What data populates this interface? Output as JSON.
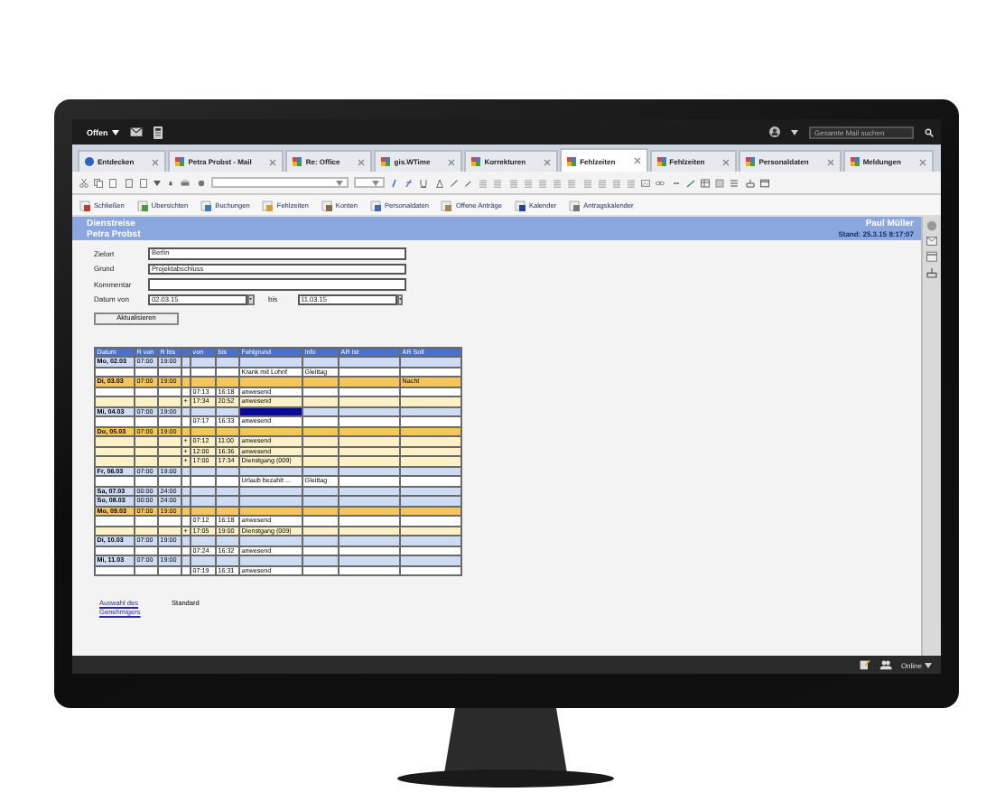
{
  "topbar": {
    "menu": "Offen",
    "search": {
      "placeholder": "Gesamte Mail suchen"
    }
  },
  "tabs": [
    {
      "label": "Entdecken",
      "selected": false
    },
    {
      "label": "Petra Probst - Mail",
      "selected": false
    },
    {
      "label": "Re: Office",
      "selected": false
    },
    {
      "label": "gis.WTime",
      "selected": false
    },
    {
      "label": "Korrekturen",
      "selected": false
    },
    {
      "label": "Fehlzeiten",
      "selected": true
    },
    {
      "label": "Fehlzeiten",
      "selected": false
    },
    {
      "label": "Personaldaten",
      "selected": false
    },
    {
      "label": "Meldungen",
      "selected": false
    }
  ],
  "app_toolbar": [
    "Schließen",
    "Übersichten",
    "Buchungen",
    "Fehlzeiten",
    "Konten",
    "Personaldaten",
    "Offene Anträge",
    "Kalender",
    "Antragskalender"
  ],
  "header": {
    "title": "Dienstreise",
    "person": "Petra Probst",
    "user": "Paul Müller",
    "stand": "Stand: 25.3.15 8:17:07"
  },
  "form": {
    "fields": [
      {
        "label": "Zielort",
        "value": "Berlin"
      },
      {
        "label": "Grund",
        "value": "Projektabschluss"
      },
      {
        "label": "Kommentar"
      }
    ],
    "date": {
      "label": "Datum",
      "from_label": "von",
      "from": "02.03.15",
      "to_label": "bis",
      "to": "11.03.15"
    },
    "button": "Aktualisieren"
  },
  "table": {
    "columns": [
      "Datum",
      "R von",
      "R bis",
      "von",
      "bis",
      "Fehlgrund",
      "Info",
      "AR Ist",
      "AR Soll"
    ],
    "rows": [
      {
        "kind": "day",
        "date": "Mo, 02.03",
        "r_from": "07:00",
        "r_to": "19:00",
        "highlighted": false
      },
      {
        "kind": "entry",
        "reason": "Krank mit Lohnf",
        "info": "Gleittag",
        "highlighted": false
      },
      {
        "kind": "day-flagged",
        "date": "Di, 03.03",
        "r_from": "07:00",
        "r_to": "19:00",
        "ar_soll": "Nacht",
        "highlighted": false
      },
      {
        "kind": "entry",
        "from": "07:13",
        "to": "16:18",
        "reason": "anwesend",
        "highlighted": false
      },
      {
        "kind": "entry-extra",
        "mark": "+",
        "from": "17:34",
        "to": "20:52",
        "reason": "anwesend",
        "highlighted": false
      },
      {
        "kind": "day",
        "date": "Mi, 04.03",
        "r_from": "07:00",
        "r_to": "19:00",
        "highlighted": true
      },
      {
        "kind": "entry",
        "from": "07:17",
        "to": "16:33",
        "reason": "anwesend",
        "highlighted": false
      },
      {
        "kind": "day-flagged",
        "date": "Do, 05.03",
        "r_from": "07:00",
        "r_to": "19:00",
        "highlighted": false
      },
      {
        "kind": "entry-extra",
        "mark": "+",
        "from": "07:12",
        "to": "11:00",
        "reason": "anwesend",
        "highlighted": false
      },
      {
        "kind": "entry-extra",
        "mark": "+",
        "from": "12:00",
        "to": "16:36",
        "reason": "anwesend",
        "highlighted": false
      },
      {
        "kind": "entry-extra",
        "mark": "+",
        "from": "17:00",
        "to": "17:34",
        "reason": "Dienstgang (009)",
        "highlighted": false
      },
      {
        "kind": "day",
        "date": "Fr, 06.03",
        "r_from": "07:00",
        "r_to": "19:00",
        "highlighted": false
      },
      {
        "kind": "entry",
        "reason": "Urlaub bezahlt ...",
        "info": "Gleittag",
        "highlighted": false
      },
      {
        "kind": "day",
        "date": "Sa, 07.03",
        "r_from": "00:00",
        "r_to": "24:00",
        "highlighted": false
      },
      {
        "kind": "day",
        "date": "So, 08.03",
        "r_from": "00:00",
        "r_to": "24:00",
        "highlighted": false
      },
      {
        "kind": "day-flagged",
        "date": "Mo, 09.03",
        "r_from": "07:00",
        "r_to": "19:00",
        "highlighted": false
      },
      {
        "kind": "entry",
        "from": "07:12",
        "to": "16:18",
        "reason": "anwesend",
        "highlighted": false
      },
      {
        "kind": "entry-extra",
        "mark": "+",
        "from": "17:05",
        "to": "19:00",
        "reason": "Dienstgang (009)",
        "highlighted": false
      },
      {
        "kind": "day",
        "date": "Di, 10.03",
        "r_from": "07:00",
        "r_to": "19:00",
        "highlighted": false
      },
      {
        "kind": "entry",
        "from": "07:24",
        "to": "16:32",
        "reason": "anwesend",
        "highlighted": false
      },
      {
        "kind": "day",
        "date": "Mi, 11.03",
        "r_from": "07:00",
        "r_to": "19:00",
        "highlighted": false
      },
      {
        "kind": "entry",
        "from": "07:19",
        "to": "16:31",
        "reason": "anwesend",
        "highlighted": false
      }
    ]
  },
  "footer": {
    "link": "Auswahl des Genehmigers",
    "value": "Standard"
  },
  "status_bar": {
    "status": "Online"
  }
}
